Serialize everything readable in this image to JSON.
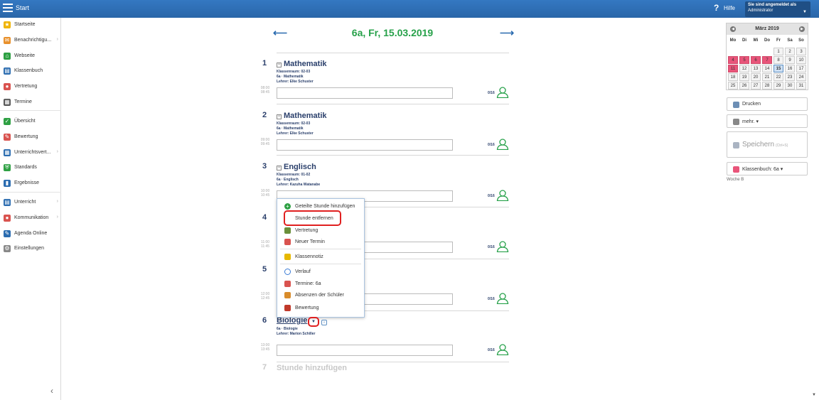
{
  "topbar": {
    "start": "Start",
    "help_icon": "?",
    "help": "Hilfe",
    "user_line1": "Sie sind angemeldet als",
    "user_line2": "Administrator"
  },
  "sidebar": {
    "items": [
      {
        "label": "Startseite",
        "icon": "star-icon"
      },
      {
        "label": "Benachrichtigu...",
        "icon": "mail-icon"
      },
      {
        "label": "Webseite",
        "icon": "home-icon"
      },
      {
        "label": "Klassenbuch",
        "icon": "book-icon"
      },
      {
        "label": "Vertretung",
        "icon": "person-icon"
      },
      {
        "label": "Termine",
        "icon": "calendar-icon"
      },
      {
        "label": "Übersicht",
        "icon": "check-icon"
      },
      {
        "label": "Bewertung",
        "icon": "grade-icon"
      },
      {
        "label": "Unterrichtsvert...",
        "icon": "grid-icon"
      },
      {
        "label": "Standards",
        "icon": "shield-icon"
      },
      {
        "label": "Ergebnisse",
        "icon": "bar-chart-icon"
      },
      {
        "label": "Unterricht",
        "icon": "class-icon"
      },
      {
        "label": "Kommunikation",
        "icon": "chat-icon"
      },
      {
        "label": "Agenda Online",
        "icon": "pen-icon"
      },
      {
        "label": "Einstellungen",
        "icon": "gear-icon"
      }
    ]
  },
  "main": {
    "title": "6a, Fr, 15.03.2019",
    "lessons": [
      {
        "num": "1",
        "title": "Mathematik",
        "room": "Klassenraum:  02-03",
        "course": "6a · Mathematik",
        "teacher": "Lehrer:  Elke Schuster",
        "time1": "08:00",
        "time2": "08:45",
        "count": "0/16"
      },
      {
        "num": "2",
        "title": "Mathematik",
        "room": "Klassenraum:  02-03",
        "course": "6a · Mathematik",
        "teacher": "Lehrer:  Elke Schuster",
        "time1": "09:00",
        "time2": "09:45",
        "count": "0/16"
      },
      {
        "num": "3",
        "title": "Englisch",
        "room": "Klassenraum:  01-02",
        "course": "6a · Englisch",
        "teacher": "Lehrer:  Kazuha Watanabe",
        "time1": "10:00",
        "time2": "10:45",
        "count": "0/16"
      },
      {
        "num": "4",
        "time1": "11:00",
        "time2": "11:45",
        "count": "0/16"
      },
      {
        "num": "5",
        "time1": "12:00",
        "time2": "12:45",
        "count": "0/16"
      },
      {
        "num": "6",
        "title": "Biologie",
        "course": "6a · Biologie",
        "teacher": "Lehrer:  Marion Schiller",
        "time1": "13:00",
        "time2": "13:45",
        "count": "0/16"
      }
    ],
    "add_num": "7",
    "add_label": "Stunde hinzufügen"
  },
  "dropdown": {
    "items": [
      {
        "label": "Geteilte Stunde hinzufügen",
        "color": "#2ea043"
      },
      {
        "label": "Stunde entfernen",
        "color": "#ffffff"
      },
      {
        "label": "Vertretung",
        "color": "#6a8f3a"
      },
      {
        "label": "Neuer Termin",
        "color": "#d9534f"
      },
      {
        "label": "Klassennotiz",
        "color": "#e6b800"
      },
      {
        "label": "Verlauf",
        "color": "#3a7bd5"
      },
      {
        "label": "Termine: 6a",
        "color": "#d9534f"
      },
      {
        "label": "Absenzen der Schüler",
        "color": "#d98c2b"
      },
      {
        "label": "Bewertung",
        "color": "#c0392b"
      }
    ]
  },
  "calendar": {
    "month": "März 2019",
    "dow": [
      "Mo",
      "Di",
      "Mi",
      "Do",
      "Fr",
      "Sa",
      "So"
    ],
    "weeks": [
      [
        "",
        "",
        "",
        "",
        "1",
        "2",
        "3"
      ],
      [
        "4",
        "5",
        "6",
        "7",
        "8",
        "9",
        "10"
      ],
      [
        "11",
        "12",
        "13",
        "14",
        "15",
        "16",
        "17"
      ],
      [
        "18",
        "19",
        "20",
        "21",
        "22",
        "23",
        "24"
      ],
      [
        "25",
        "26",
        "27",
        "28",
        "29",
        "30",
        "31"
      ]
    ],
    "highlighted": [
      "4",
      "5",
      "6",
      "7",
      "11"
    ],
    "selected": "15"
  },
  "right": {
    "print": "Drucken",
    "more": "mehr. ▾",
    "save": "Speichern",
    "save_hint": "(Ctrl+S)",
    "classbook": "Klassenbuch: 6a ▾",
    "week": "Woche B"
  },
  "colors": {
    "accent": "#2b6cb0",
    "title_green": "#27a14a",
    "highlight_red": "#e02020",
    "calendar_red": "#e9557a"
  }
}
